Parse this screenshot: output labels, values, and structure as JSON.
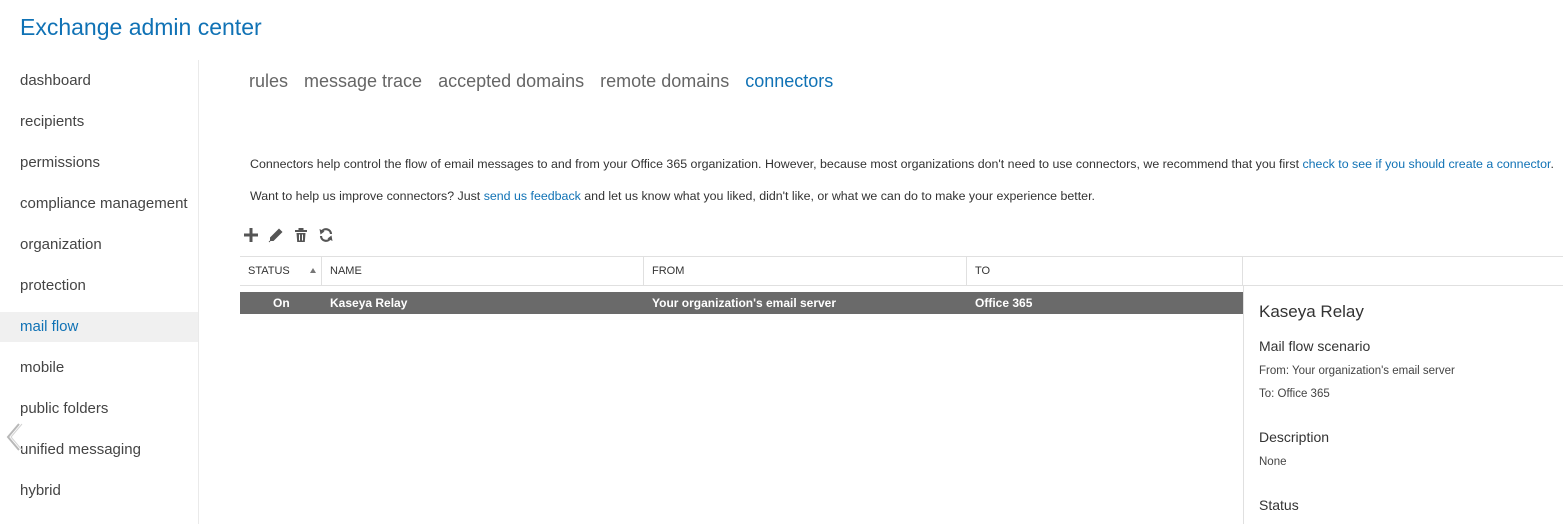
{
  "app": {
    "title": "Exchange admin center"
  },
  "sidebar": {
    "items": [
      {
        "label": "dashboard"
      },
      {
        "label": "recipients"
      },
      {
        "label": "permissions"
      },
      {
        "label": "compliance management"
      },
      {
        "label": "organization"
      },
      {
        "label": "protection"
      },
      {
        "label": "mail flow",
        "active": true
      },
      {
        "label": "mobile"
      },
      {
        "label": "public folders"
      },
      {
        "label": "unified messaging"
      },
      {
        "label": "hybrid"
      }
    ],
    "collapse_icon": "chevron-left-icon"
  },
  "tabs": [
    {
      "label": "rules"
    },
    {
      "label": "message trace"
    },
    {
      "label": "accepted domains"
    },
    {
      "label": "remote domains"
    },
    {
      "label": "connectors",
      "active": true
    }
  ],
  "intro": {
    "text": "Connectors help control the flow of email messages to and from your Office 365 organization. However, because most organizations don't need to use connectors, we recommend that you first ",
    "link": "check to see if you should create a connector",
    "end": "."
  },
  "feedback": {
    "before": "Want to help us improve connectors? Just ",
    "link": "send us feedback",
    "after": " and let us know what you liked, didn't like, or what we can do to make your experience better."
  },
  "toolbar": {
    "buttons": [
      {
        "icon": "add-icon"
      },
      {
        "icon": "edit-icon"
      },
      {
        "icon": "delete-icon"
      },
      {
        "icon": "refresh-icon"
      }
    ]
  },
  "grid": {
    "columns": {
      "status": "STATUS",
      "name": "NAME",
      "from": "FROM",
      "to": "TO"
    },
    "rows": [
      {
        "status": "On",
        "name": "Kaseya Relay",
        "from": "Your organization's email server",
        "to": "Office 365"
      }
    ]
  },
  "details": {
    "title": "Kaseya Relay",
    "scenario_heading": "Mail flow scenario",
    "from": "From: Your organization's email server",
    "to": "To: Office 365",
    "description_heading": "Description",
    "description": "None",
    "status_heading": "Status"
  },
  "colors": {
    "accent": "#1072b5",
    "selected_row": "#6a6a6a"
  }
}
